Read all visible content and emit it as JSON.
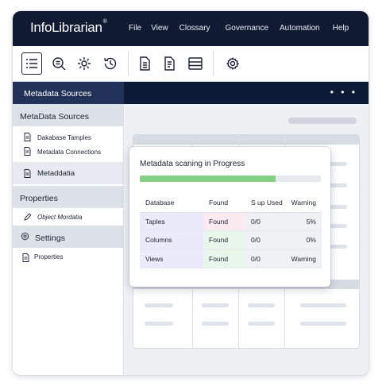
{
  "app": {
    "name": "InfoLibrarian",
    "trademark": "®"
  },
  "menu": [
    "File",
    "View",
    "Clossary",
    "Governance",
    "Automation",
    "Help"
  ],
  "toolbar": {
    "icons": [
      "list-icon",
      "search-doc-icon",
      "settings-cog-icon",
      "history-icon",
      "document-icon",
      "document-lines-icon",
      "layout-icon",
      "gear-icon"
    ]
  },
  "header": {
    "title": "Metadata Sources",
    "more": "• • •"
  },
  "sidebar": {
    "metadata_sources": {
      "label": "MetaData Sources",
      "items": [
        "Dakabase Tamples",
        "Metadata Connections"
      ]
    },
    "metaddatia": "Metaddatia",
    "properties": {
      "label": "Properties",
      "items": [
        "Object Mordatia"
      ]
    },
    "settings": {
      "label": "Settings",
      "items": [
        "Properties"
      ]
    }
  },
  "dialog": {
    "title": "Metadata scaning in Progress",
    "progress_percent": 75,
    "columns": [
      "Database",
      "Found",
      "S up Used",
      "Warning"
    ],
    "rows": [
      {
        "name": "Taples",
        "found": "Found",
        "sup_used": "0/0",
        "warning": "5%"
      },
      {
        "name": "Columns",
        "found": "Found",
        "sup_used": "0/0",
        "warning": "0%"
      },
      {
        "name": "Views",
        "found": "Found",
        "sup_used": "0/0",
        "warning": "Warning"
      }
    ]
  },
  "colors": {
    "titlebar": "#111a33",
    "accent_progress": "#86cf86",
    "found_pink": "#e0578a",
    "found_green": "#2e9d47"
  }
}
